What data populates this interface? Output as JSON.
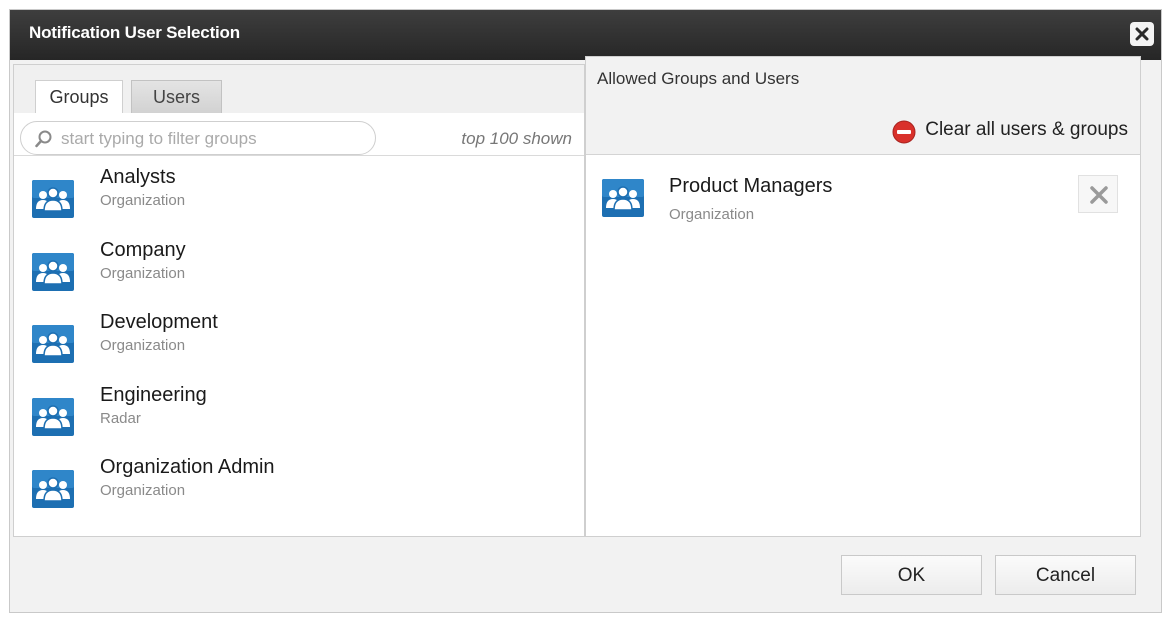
{
  "dialog": {
    "title": "Notification User Selection",
    "close_icon": "close-icon"
  },
  "left": {
    "tabs": [
      {
        "label": "Groups",
        "active": true
      },
      {
        "label": "Users",
        "active": false
      }
    ],
    "search": {
      "placeholder": "start typing to filter groups",
      "value": "",
      "icon": "search-icon"
    },
    "limit_note": "top 100 shown",
    "groups": [
      {
        "name": "Analysts",
        "type": "Organization",
        "icon": "group-icon"
      },
      {
        "name": "Company",
        "type": "Organization",
        "icon": "group-icon"
      },
      {
        "name": "Development",
        "type": "Organization",
        "icon": "group-icon"
      },
      {
        "name": "Engineering",
        "type": "Radar",
        "icon": "group-icon"
      },
      {
        "name": "Organization Admin",
        "type": "Organization",
        "icon": "group-icon"
      }
    ]
  },
  "right": {
    "header": "Allowed Groups and Users",
    "clear_label": "Clear all users & groups",
    "clear_icon": "remove-circle-icon",
    "selected": [
      {
        "name": "Product Managers",
        "type": "Organization",
        "icon": "group-icon"
      }
    ],
    "remove_icon": "close-x-icon"
  },
  "footer": {
    "ok_label": "OK",
    "cancel_label": "Cancel"
  },
  "colors": {
    "titlebar": "#2f2f2f",
    "icon_blue": "#1d6fb2",
    "clear_red": "#d9312b"
  }
}
